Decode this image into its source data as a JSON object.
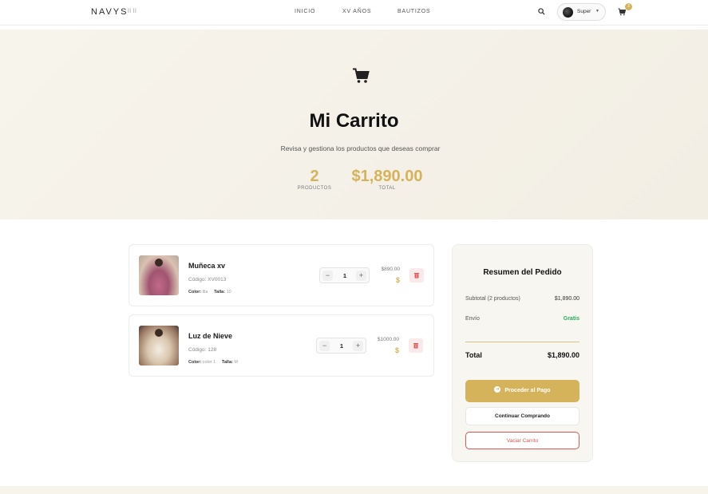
{
  "header": {
    "logo": "NAVYS",
    "logo_sub": "ꟾꟾ ꟾꟾ",
    "nav": [
      "INICIO",
      "XV AÑOS",
      "BAUTIZOS"
    ],
    "user_name": "Super",
    "cart_count": "3",
    "icons": {
      "search": "search-icon",
      "cart": "cart-icon",
      "caret": "chevron-down-icon"
    }
  },
  "hero": {
    "title": "Mi Carrito",
    "subtitle": "Revisa y gestiona los productos que deseas comprar",
    "stats": [
      {
        "value": "2",
        "label": "PRODUCTOS"
      },
      {
        "value": "$1,890.00",
        "label": "TOTAL"
      }
    ]
  },
  "items": [
    {
      "name": "Muñeca xv",
      "code": "Código: XV0013",
      "color_label": "Color:",
      "color_value": "lila",
      "size_label": "Talla:",
      "size_value": "10",
      "quantity": "1",
      "price": "$890.00",
      "currency": "$"
    },
    {
      "name": "Luz de Nieve",
      "code": "Código: 128",
      "color_label": "Color:",
      "color_value": "color 1",
      "size_label": "Talla:",
      "size_value": "M",
      "quantity": "1",
      "price": "$1000.00",
      "currency": "$"
    }
  ],
  "summary": {
    "title": "Resumen del Pedido",
    "subtotal_label": "Subtotal (2 productos)",
    "subtotal_value": "$1,890.00",
    "shipping_label": "Envío",
    "shipping_value": "Gratis",
    "total_label": "Total",
    "total_value": "$1,890.00",
    "pay_button": "Proceder al Pago",
    "continue_button": "Continuar Comprando",
    "empty_button": "Vaciar Carrito"
  },
  "colors": {
    "accent": "#d4b35a",
    "hero_bg": "#f4f1e8",
    "success": "#27ae60",
    "danger": "#e05555"
  }
}
